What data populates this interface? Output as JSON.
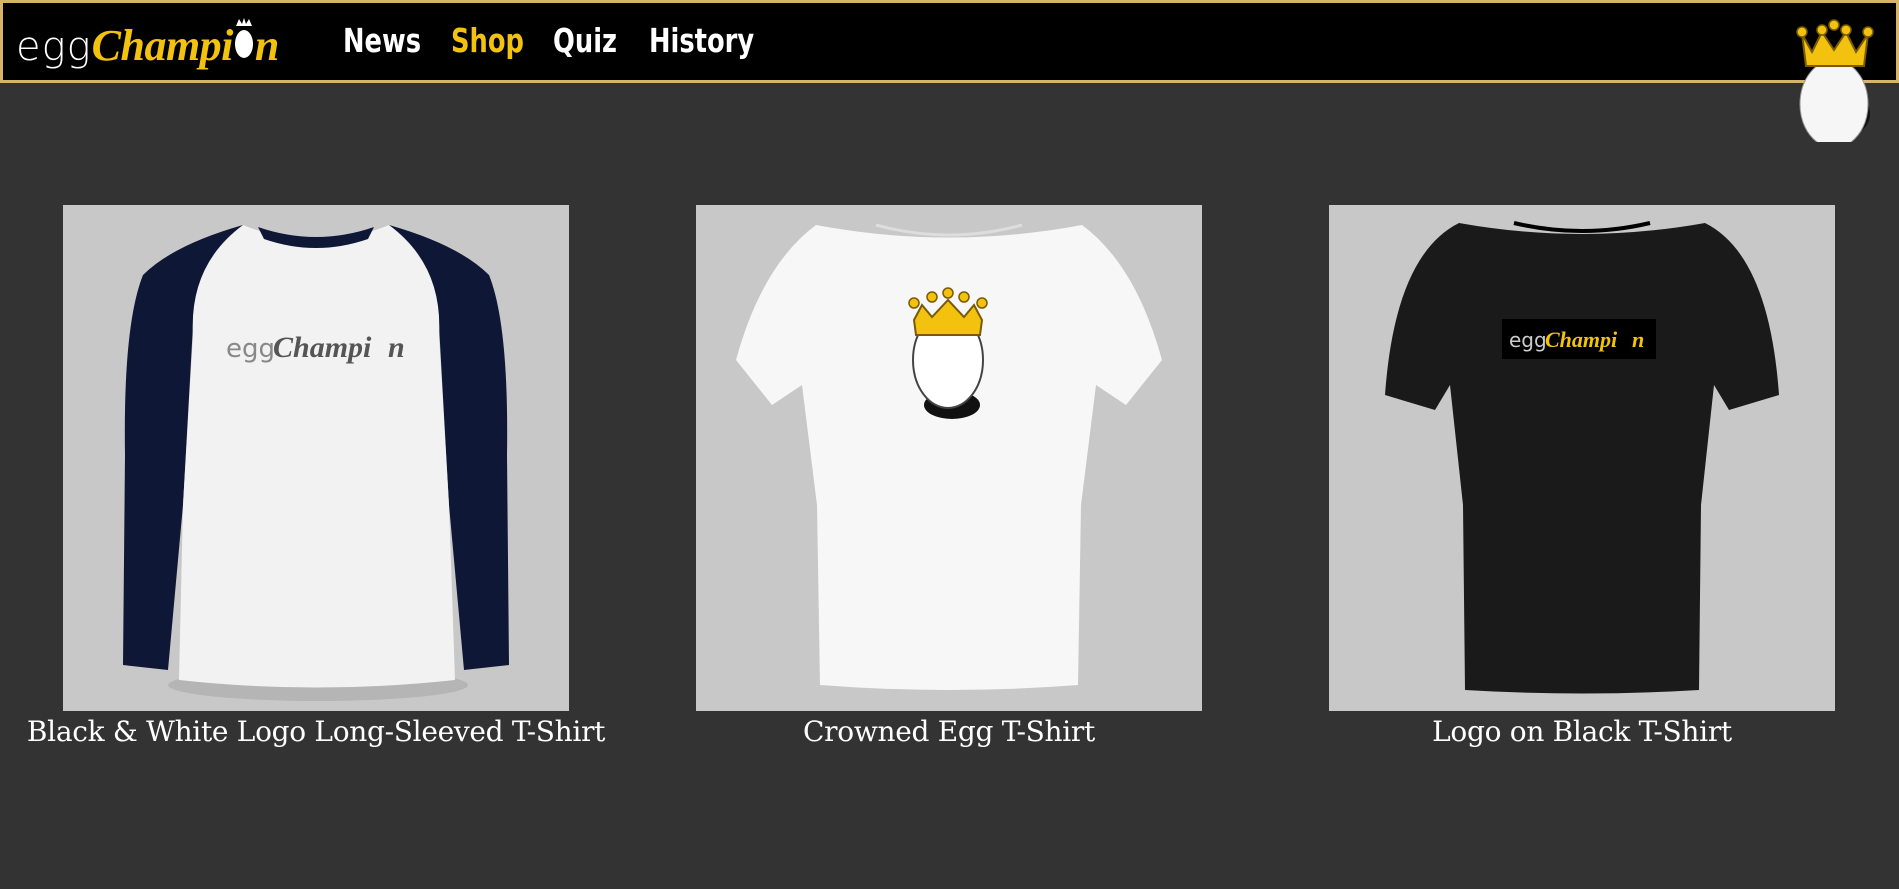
{
  "header": {
    "logo": {
      "egg_text": "egg",
      "champion_text": "Champi",
      "champion_suffix": "n"
    },
    "nav": [
      {
        "label": "News",
        "active": false
      },
      {
        "label": "Shop",
        "active": true
      },
      {
        "label": "Quiz",
        "active": false
      },
      {
        "label": "History",
        "active": false
      }
    ],
    "corner_icon": "crowned-egg-icon"
  },
  "products": [
    {
      "title": "Black & White Logo Long-Sleeved T-Shirt",
      "image": "long-sleeve-raglan-shirt",
      "print": {
        "egg_text": "egg",
        "champion_text": "Champi",
        "champion_suffix": "n"
      }
    },
    {
      "title": "Crowned Egg T-Shirt",
      "image": "white-tshirt-crowned-egg"
    },
    {
      "title": "Logo on Black T-Shirt",
      "image": "black-tshirt-logo",
      "print": {
        "egg_text": "egg",
        "champion_text": "Champi",
        "champion_suffix": "n"
      }
    }
  ],
  "colors": {
    "background": "#333333",
    "header_bg": "#000000",
    "header_border": "#d8b36a",
    "accent_gold": "#f2c20f",
    "text": "#ffffff",
    "thumb_bg": "#c8c8c8"
  }
}
